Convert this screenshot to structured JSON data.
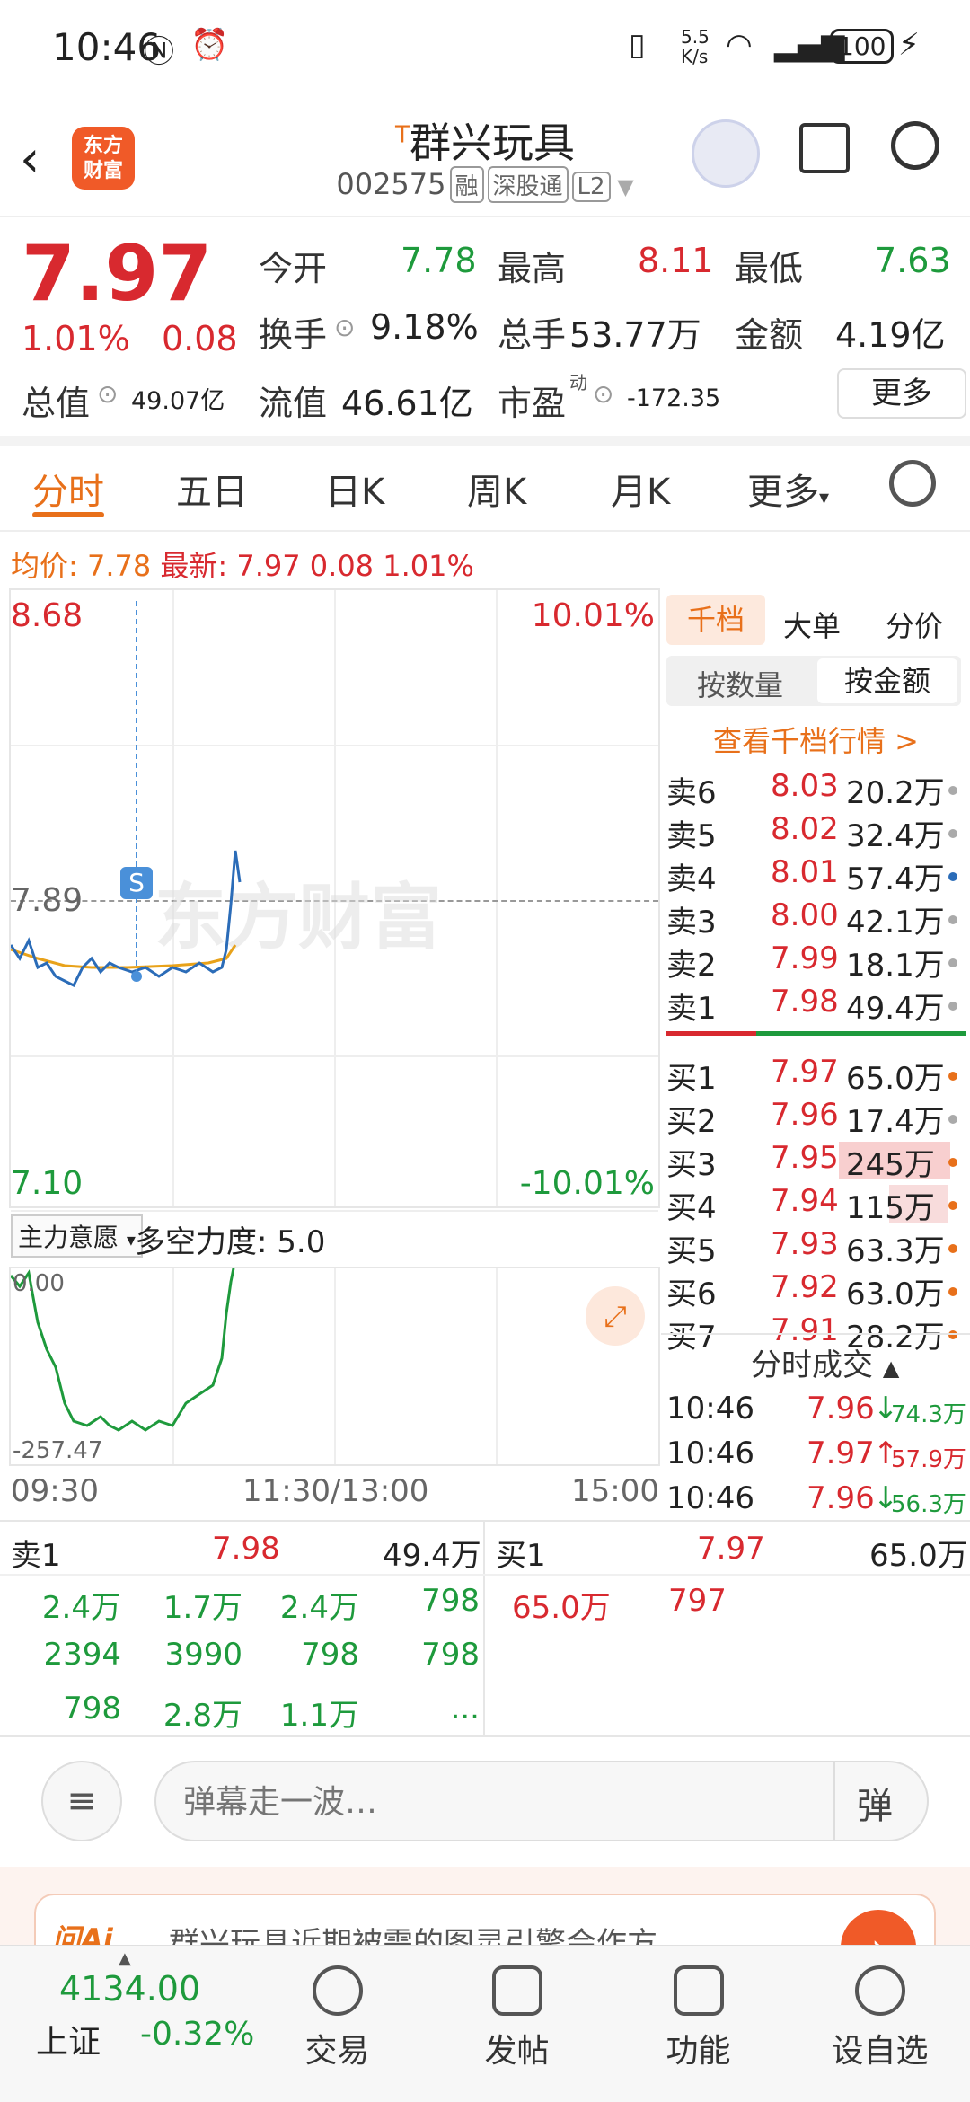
{
  "status": {
    "time": "10:46",
    "net_speed": "5.5\nK/s",
    "battery": "100"
  },
  "header": {
    "title_prefix": "T",
    "title": "群兴玩具",
    "code": "002575",
    "tags": [
      "融",
      "深股通",
      "L2"
    ],
    "logo": "东方\n财富"
  },
  "quote": {
    "price": "7.97",
    "pct": "1.01%",
    "change": "0.08",
    "open_label": "今开",
    "open": "7.78",
    "high_label": "最高",
    "high": "8.11",
    "low_label": "最低",
    "low": "7.63",
    "turnover_label": "换手",
    "turnover": "9.18%",
    "volume_label": "总手",
    "volume": "53.77万",
    "amount_label": "金额",
    "amount": "4.19亿",
    "mktcap_label": "总值",
    "mktcap": "49.07亿",
    "float_label": "流值",
    "float": "46.61亿",
    "pe_label": "市盈",
    "pe_sup": "动",
    "pe": "-172.35",
    "more": "更多"
  },
  "tabs": [
    "分时",
    "五日",
    "日K",
    "周K",
    "月K",
    "更多"
  ],
  "avg_line": {
    "avg_label": "均价:",
    "avg": "7.78",
    "new_label": "最新:",
    "new": "7.97",
    "chg": "0.08",
    "pct": "1.01%"
  },
  "chart": {
    "top_price": "8.68",
    "top_pct": "10.01%",
    "mid_price": "7.89",
    "bot_price": "7.10",
    "bot_pct": "-10.01%",
    "watermark": "东方财富",
    "marker": "S",
    "indicator": "主力意愿",
    "force_label": "多空力度: 5.0",
    "sub_top": "0.00",
    "sub_bot": "-257.47",
    "time_start": "09:30",
    "time_mid": "11:30/13:00",
    "time_end": "15:00",
    "colors": {
      "price": "#2b6cb8",
      "avg": "#e8a21a",
      "sub": "#1e9a3c"
    }
  },
  "orderbook": {
    "tabs": [
      "千档",
      "大单",
      "分价"
    ],
    "subtabs": [
      "按数量",
      "按金额"
    ],
    "link": "查看千档行情 >",
    "asks": [
      {
        "label": "卖6",
        "price": "8.03",
        "vol": "20.2万"
      },
      {
        "label": "卖5",
        "price": "8.02",
        "vol": "32.4万"
      },
      {
        "label": "卖4",
        "price": "8.01",
        "vol": "57.4万"
      },
      {
        "label": "卖3",
        "price": "8.00",
        "vol": "42.1万"
      },
      {
        "label": "卖2",
        "price": "7.99",
        "vol": "18.1万"
      },
      {
        "label": "卖1",
        "price": "7.98",
        "vol": "49.4万"
      }
    ],
    "bids": [
      {
        "label": "买1",
        "price": "7.97",
        "vol": "65.0万"
      },
      {
        "label": "买2",
        "price": "7.96",
        "vol": "17.4万"
      },
      {
        "label": "买3",
        "price": "7.95",
        "vol": "245万"
      },
      {
        "label": "买4",
        "price": "7.94",
        "vol": "115万"
      },
      {
        "label": "买5",
        "price": "7.93",
        "vol": "63.3万"
      },
      {
        "label": "买6",
        "price": "7.92",
        "vol": "63.0万"
      },
      {
        "label": "买7",
        "price": "7.91",
        "vol": "28.2万"
      }
    ],
    "trades_title": "分时成交",
    "trades": [
      {
        "time": "10:46",
        "price": "7.96",
        "dir": "↓",
        "vol": "74.3万"
      },
      {
        "time": "10:46",
        "price": "7.97",
        "dir": "↑",
        "vol": "57.9万"
      },
      {
        "time": "10:46",
        "price": "7.96",
        "dir": "↓",
        "vol": "56.3万"
      }
    ]
  },
  "queue": {
    "sell_label": "卖1",
    "sell_price": "7.98",
    "sell_vol": "49.4万",
    "buy_label": "买1",
    "buy_price": "7.97",
    "buy_vol": "65.0万",
    "sell_items": [
      "2.4万",
      "1.7万",
      "2.4万",
      "798",
      "2394",
      "3990",
      "798",
      "798",
      "798",
      "2.8万",
      "1.1万",
      "..."
    ],
    "buy_items": [
      "65.0万",
      "797"
    ]
  },
  "comment": {
    "placeholder": "弹幕走一波…",
    "danmu": "弹"
  },
  "ai_banner": "群兴玩具近期被需的图灵引擎会作方",
  "bottom": {
    "index_value": "4134.00",
    "index_name": "上证",
    "index_pct": "-0.32%",
    "items": [
      "交易",
      "发帖",
      "功能",
      "设自选"
    ]
  }
}
